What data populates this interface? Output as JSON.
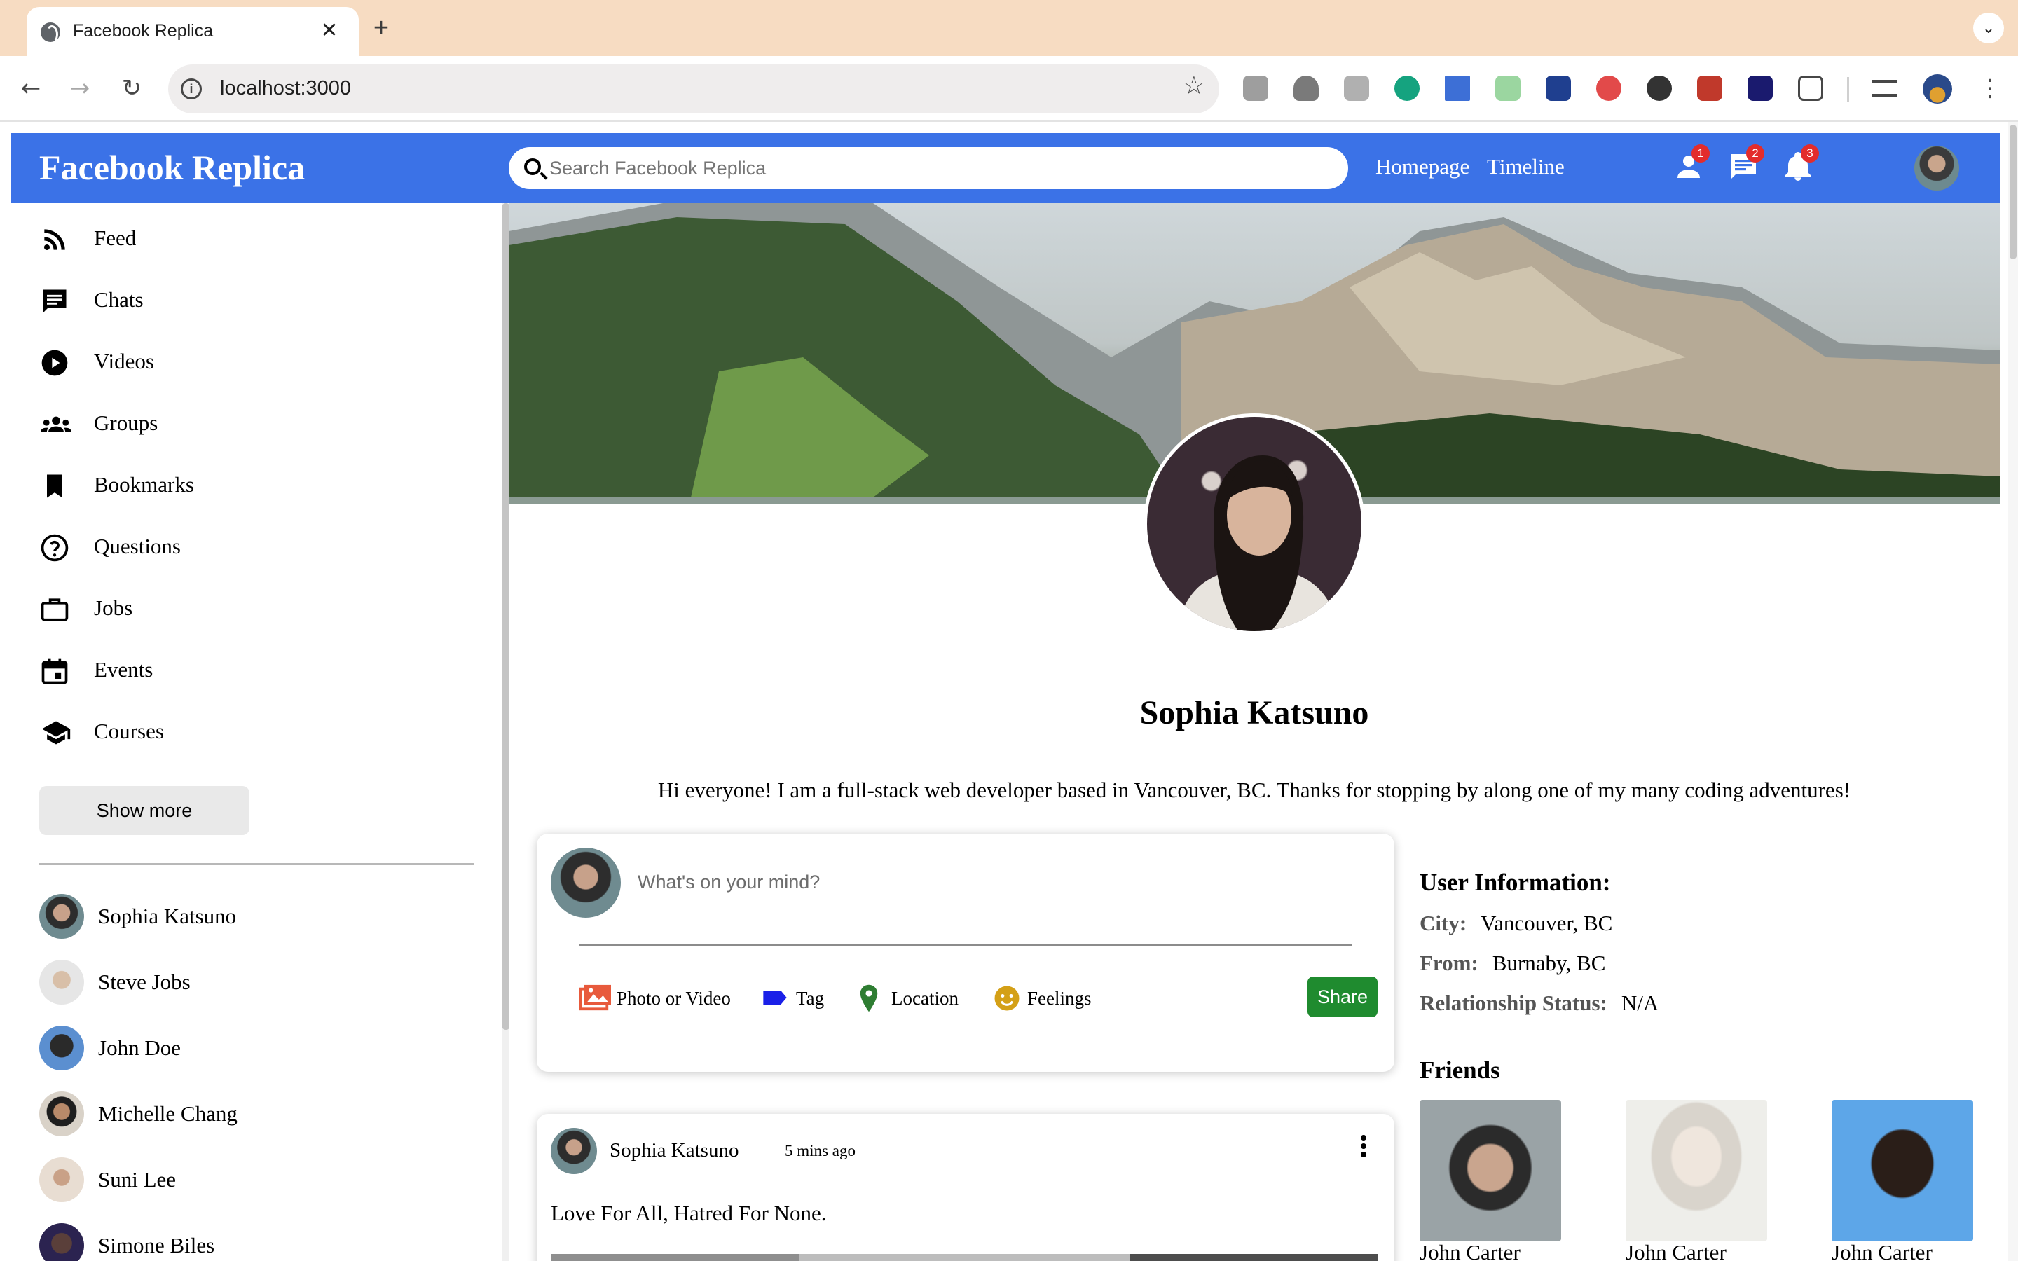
{
  "browser": {
    "tab_title": "Facebook Replica",
    "tab_close": "✕",
    "new_tab": "+",
    "url": "localhost:3000",
    "icons": [
      "globe-icon",
      "back-arrow-icon",
      "forward-arrow-icon",
      "reload-icon",
      "info-icon",
      "star-icon",
      "extensions-icon",
      "chrome-menu-icon"
    ]
  },
  "header": {
    "logo": "Facebook Replica",
    "search_placeholder": "Search Facebook Replica",
    "links": [
      "Homepage",
      "Timeline"
    ],
    "badges": {
      "friends": "1",
      "messages": "2",
      "notifications": "3"
    },
    "accent_color": "#3b72e7"
  },
  "sidebar": {
    "items": [
      {
        "label": "Feed",
        "icon": "rss-feed-icon"
      },
      {
        "label": "Chats",
        "icon": "chat-icon"
      },
      {
        "label": "Videos",
        "icon": "play-circle-icon"
      },
      {
        "label": "Groups",
        "icon": "groups-icon"
      },
      {
        "label": "Bookmarks",
        "icon": "bookmark-icon"
      },
      {
        "label": "Questions",
        "icon": "help-circle-icon"
      },
      {
        "label": "Jobs",
        "icon": "briefcase-icon"
      },
      {
        "label": "Events",
        "icon": "calendar-icon"
      },
      {
        "label": "Courses",
        "icon": "graduation-cap-icon"
      }
    ],
    "show_more": "Show more",
    "friends": [
      "Sophia Katsuno",
      "Steve Jobs",
      "John Doe",
      "Michelle Chang",
      "Suni Lee",
      "Simone Biles"
    ]
  },
  "profile": {
    "name": "Sophia Katsuno",
    "bio": "Hi everyone! I am a full-stack web developer based in Vancouver, BC. Thanks for stopping by along one of my many coding adventures!"
  },
  "share": {
    "placeholder": "What's on your mind?",
    "options": [
      {
        "label": "Photo or Video",
        "icon": "photo-icon",
        "color": "#e85a3c"
      },
      {
        "label": "Tag",
        "icon": "tag-icon",
        "color": "#1a20e8"
      },
      {
        "label": "Location",
        "icon": "location-pin-icon",
        "color": "#2e7d32"
      },
      {
        "label": "Feelings",
        "icon": "emoji-icon",
        "color": "#d4a017"
      }
    ],
    "button": "Share",
    "button_color": "#1f8b2f"
  },
  "post": {
    "author": "Sophia Katsuno",
    "time": "5 mins ago",
    "text": "Love For All, Hatred For None."
  },
  "user_info": {
    "title": "User Information:",
    "rows": [
      {
        "key": "City:",
        "value": "Vancouver, BC"
      },
      {
        "key": "From:",
        "value": "Burnaby, BC"
      },
      {
        "key": "Relationship Status:",
        "value": "N/A"
      }
    ]
  },
  "friends_panel": {
    "title": "Friends",
    "items": [
      "John Carter",
      "John Carter",
      "John Carter"
    ]
  }
}
